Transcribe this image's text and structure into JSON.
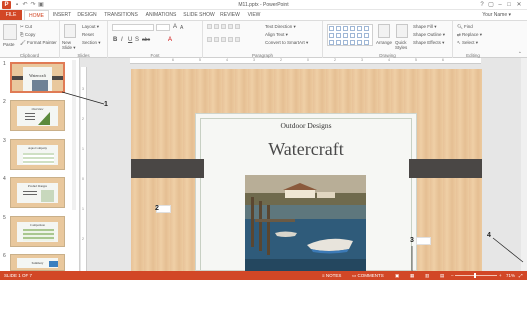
{
  "window": {
    "title": "M11.pptx - PowerPoint",
    "app_icon": "P",
    "qat_icons": [
      "save-icon",
      "undo-icon",
      "redo-icon",
      "start-slideshow-icon"
    ],
    "controls": [
      "?",
      "▢",
      "–",
      "□",
      "✕"
    ]
  },
  "tabs": {
    "file": "FILE",
    "items": [
      "HOME",
      "INSERT",
      "DESIGN",
      "TRANSITIONS",
      "ANIMATIONS",
      "SLIDE SHOW",
      "REVIEW",
      "VIEW"
    ],
    "active": "HOME",
    "user": "Your Name ▾"
  },
  "ribbon": {
    "clipboard": {
      "label": "Clipboard",
      "paste": "Paste",
      "cut": "Cut",
      "copy": "Copy",
      "format_painter": "Format Painter"
    },
    "slides": {
      "label": "Slides",
      "new_slide": "New Slide ▾",
      "layout": "Layout ▾",
      "reset": "Reset",
      "section": "Section ▾"
    },
    "font": {
      "label": "Font",
      "bold": "B",
      "italic": "I",
      "underline": "U",
      "strike": "S",
      "shadow": "abc",
      "size_up": "A",
      "size_down": "A",
      "color": "A"
    },
    "paragraph": {
      "label": "Paragraph",
      "text_direction": "Text Direction ▾",
      "align_text": "Align Text ▾",
      "smartart": "Convert to SmartArt ▾"
    },
    "drawing": {
      "label": "Drawing",
      "arrange": "Arrange",
      "quick_styles": "Quick Styles",
      "shape_fill": "Shape Fill ▾",
      "shape_outline": "Shape Outline ▾",
      "shape_effects": "Shape Effects ▾"
    },
    "editing": {
      "label": "Editing",
      "find": "Find",
      "replace": "Replace ▾",
      "select": "Select ▾"
    }
  },
  "thumbnails": {
    "numbers": [
      "1",
      "2",
      "3",
      "4",
      "5",
      "6"
    ],
    "titles": [
      "Watercraft",
      "Overview",
      "Aqua Company",
      "Product Ranges",
      "Comparison",
      "Summary"
    ]
  },
  "ruler": {
    "h_ticks": [
      "6",
      "5",
      "4",
      "3",
      "2",
      "1",
      "0",
      "1",
      "2",
      "3",
      "4",
      "5",
      "6"
    ],
    "v_ticks": [
      "3",
      "2",
      "1",
      "0",
      "1",
      "2",
      "3"
    ]
  },
  "slide": {
    "subtitle": "Outdoor Designs",
    "title": "Watercraft",
    "band_color": "#4a4745"
  },
  "callouts": [
    "1",
    "2",
    "3",
    "4"
  ],
  "status": {
    "slide_of": "SLIDE 1 OF 7",
    "notes": "NOTES",
    "comments": "COMMENTS",
    "zoom": "71%",
    "accent": "#d24726"
  }
}
